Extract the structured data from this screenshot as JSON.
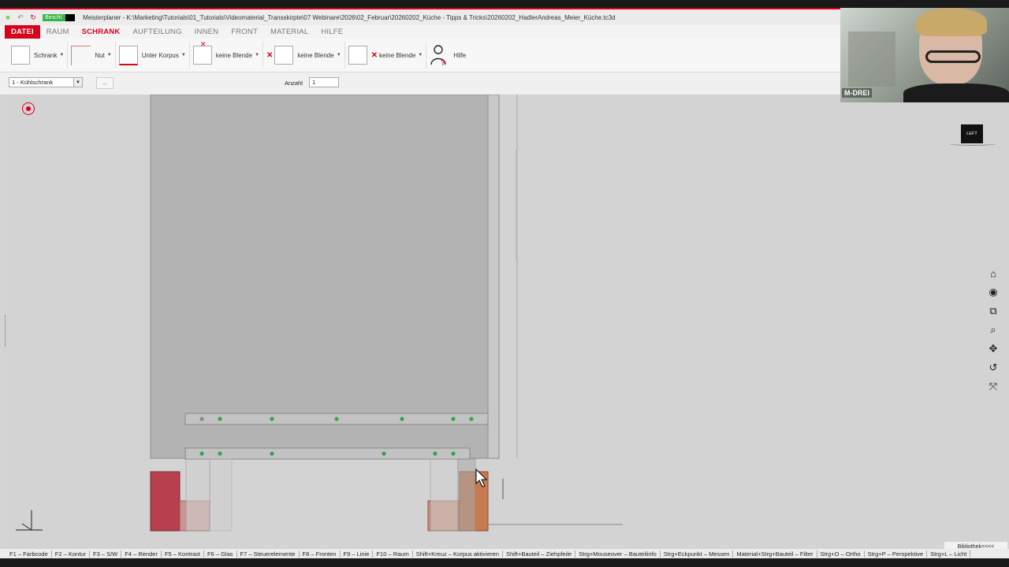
{
  "titlebar": {
    "badge": "Beschl.",
    "text": "Meisterplaner - K:\\Marketing\\Tutorials\\01_Tutorials\\Videomaterial_Transskirpte\\07 Webinare\\2026\\02_Februar\\20260202_Küche - Tipps & Tricks\\20260202_HadlerAndreas_Meier_Küche.tc3d"
  },
  "menu": {
    "file": "DATEI",
    "items": [
      "RAUM",
      "SCHRANK",
      "AUFTEILUNG",
      "INNEN",
      "FRONT",
      "MATERIAL",
      "HILFE"
    ],
    "active": "SCHRANK"
  },
  "ribbon": {
    "schrank": "Schrank",
    "nut": "Nut",
    "unterkorpus": "Unter Korpus",
    "blende1": "keine Blende",
    "blende2": "keine Blende",
    "blende3": "keine Blende",
    "hilfe": "Hilfe"
  },
  "options": {
    "selected": "1 - Kühlschrank",
    "dots": "...",
    "anzahl_label": "Anzahl",
    "anzahl_value": "1"
  },
  "viewport": {
    "navcube_label": "LEFT",
    "bibliothek": "Bibliothek<<<<"
  },
  "statusbar": [
    "F1 – Farbcode",
    "F2 – Kontur",
    "F3 – S/W",
    "F4 – Render",
    "F5 – Kontrast",
    "F6 – Glas",
    "F7 – Steuerelemente",
    "F8 – Fronten",
    "F9 – Linie",
    "F10 – Raum",
    "Shift+Kreuz – Korpus aktivieren",
    "Shift+Bauteil – Ziehpfeile",
    "Strg+Mouseover – Bauteilinfo",
    "Strg+Eckpunkt – Messen",
    "Material+Strg+Bauteil – Filter",
    "Strg+O – Ortho",
    "Strg+P – Perspektive",
    "Strg+L – Licht"
  ],
  "webcam": {
    "label": "M-DREI"
  },
  "colors": {
    "accent": "#d9001b",
    "badge": "#3ab34a"
  }
}
